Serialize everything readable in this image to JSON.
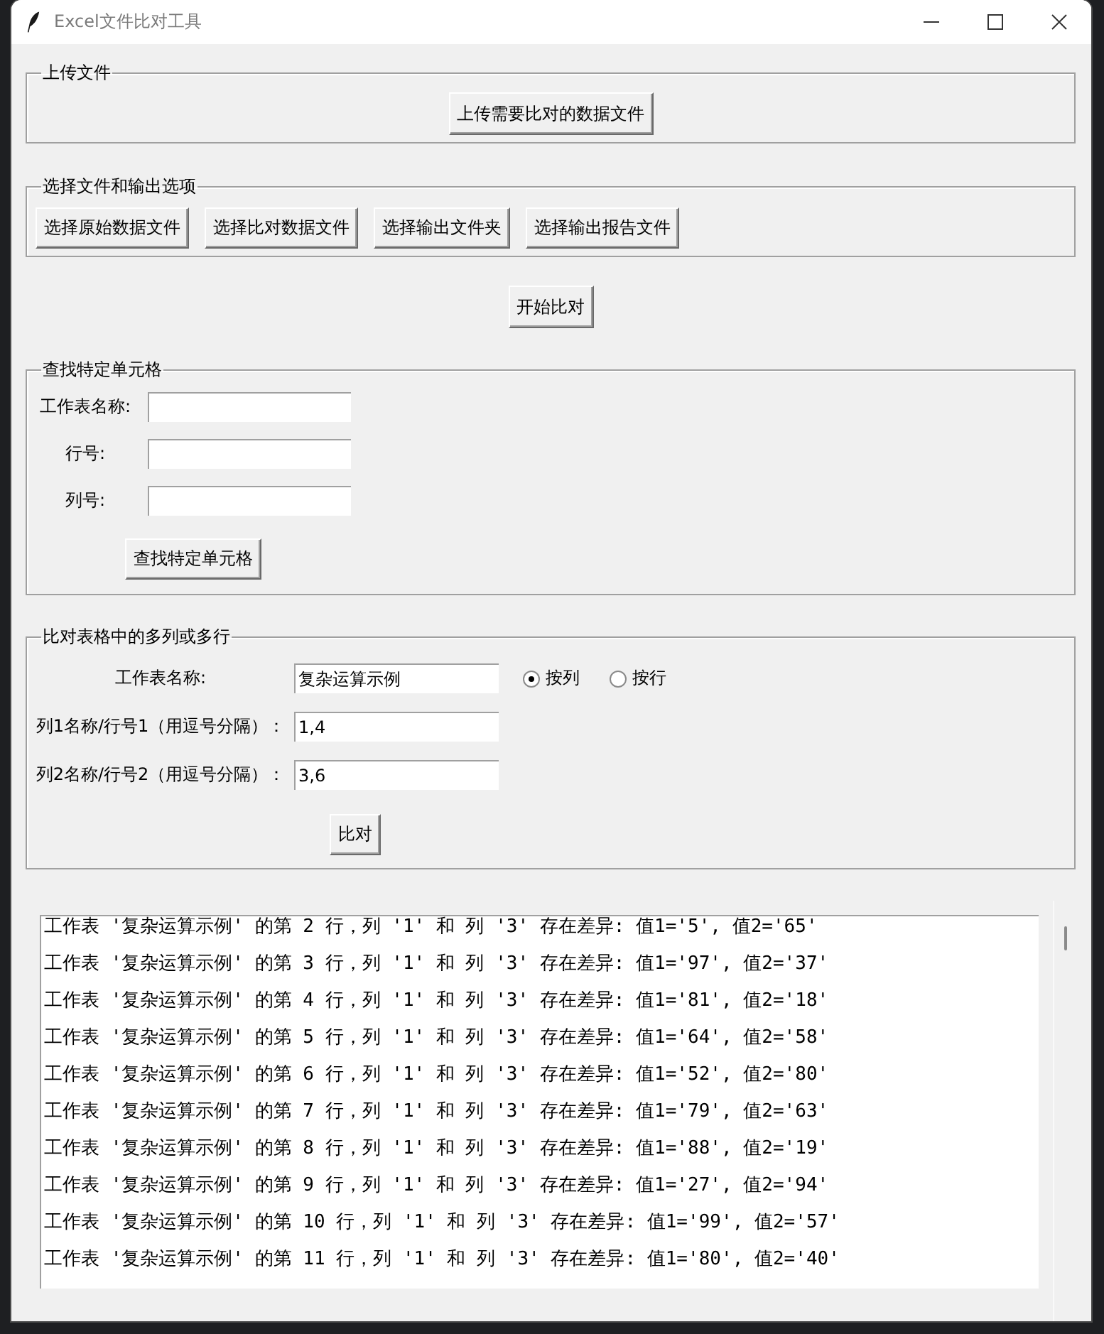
{
  "window": {
    "title": "Excel文件比对工具"
  },
  "upload_group": {
    "title": "上传文件",
    "button": "上传需要比对的数据文件"
  },
  "select_group": {
    "title": "选择文件和输出选项",
    "buttons": [
      "选择原始数据文件",
      "选择比对数据文件",
      "选择输出文件夹",
      "选择输出报告文件"
    ]
  },
  "start_button": "开始比对",
  "find_cell_group": {
    "title": "查找特定单元格",
    "fields": [
      {
        "label": "工作表名称:"
      },
      {
        "label": "行号:"
      },
      {
        "label": "列号:"
      }
    ],
    "button": "查找特定单元格"
  },
  "compare_group": {
    "title": "比对表格中的多列或多行",
    "fields": [
      {
        "label": "工作表名称:",
        "value": "复杂运算示例"
      },
      {
        "label": "列1名称/行号1（用逗号分隔）：",
        "value": "1,4"
      },
      {
        "label": "列2名称/行号2（用逗号分隔）：",
        "value": "3,6"
      }
    ],
    "modes": [
      {
        "label": "按列",
        "selected": true
      },
      {
        "label": "按行",
        "selected": false
      }
    ],
    "button": "比对"
  },
  "output": {
    "lines": [
      "工作表 '复杂运算示例' 的第 2 行，列 '1' 和 列 '3' 存在差异: 值1='5', 值2='65'",
      "工作表 '复杂运算示例' 的第 3 行，列 '1' 和 列 '3' 存在差异: 值1='97', 值2='37'",
      "工作表 '复杂运算示例' 的第 4 行，列 '1' 和 列 '3' 存在差异: 值1='81', 值2='18'",
      "工作表 '复杂运算示例' 的第 5 行，列 '1' 和 列 '3' 存在差异: 值1='64', 值2='58'",
      "工作表 '复杂运算示例' 的第 6 行，列 '1' 和 列 '3' 存在差异: 值1='52', 值2='80'",
      "工作表 '复杂运算示例' 的第 7 行，列 '1' 和 列 '3' 存在差异: 值1='79', 值2='63'",
      "工作表 '复杂运算示例' 的第 8 行，列 '1' 和 列 '3' 存在差异: 值1='88', 值2='19'",
      "工作表 '复杂运算示例' 的第 9 行，列 '1' 和 列 '3' 存在差异: 值1='27', 值2='94'",
      "工作表 '复杂运算示例' 的第 10 行，列 '1' 和 列 '3' 存在差异: 值1='99', 值2='57'",
      "工作表 '复杂运算示例' 的第 11 行，列 '1' 和 列 '3' 存在差异: 值1='80', 值2='40'"
    ]
  }
}
